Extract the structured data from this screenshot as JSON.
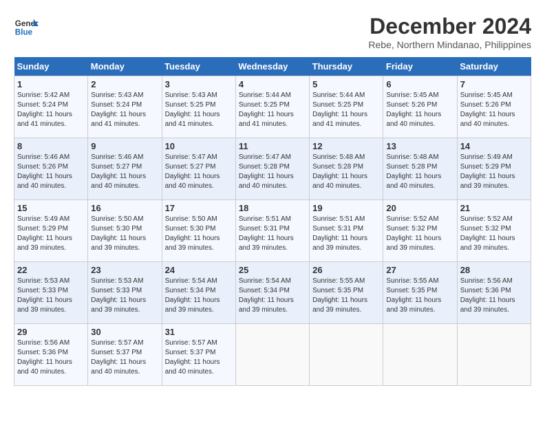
{
  "header": {
    "logo_general": "General",
    "logo_blue": "Blue",
    "month_title": "December 2024",
    "location": "Rebe, Northern Mindanao, Philippines"
  },
  "days_of_week": [
    "Sunday",
    "Monday",
    "Tuesday",
    "Wednesday",
    "Thursday",
    "Friday",
    "Saturday"
  ],
  "weeks": [
    [
      {
        "day": "1",
        "sunrise": "5:42 AM",
        "sunset": "5:24 PM",
        "daylight": "11 hours and 41 minutes."
      },
      {
        "day": "2",
        "sunrise": "5:43 AM",
        "sunset": "5:24 PM",
        "daylight": "11 hours and 41 minutes."
      },
      {
        "day": "3",
        "sunrise": "5:43 AM",
        "sunset": "5:25 PM",
        "daylight": "11 hours and 41 minutes."
      },
      {
        "day": "4",
        "sunrise": "5:44 AM",
        "sunset": "5:25 PM",
        "daylight": "11 hours and 41 minutes."
      },
      {
        "day": "5",
        "sunrise": "5:44 AM",
        "sunset": "5:25 PM",
        "daylight": "11 hours and 41 minutes."
      },
      {
        "day": "6",
        "sunrise": "5:45 AM",
        "sunset": "5:26 PM",
        "daylight": "11 hours and 40 minutes."
      },
      {
        "day": "7",
        "sunrise": "5:45 AM",
        "sunset": "5:26 PM",
        "daylight": "11 hours and 40 minutes."
      }
    ],
    [
      {
        "day": "8",
        "sunrise": "5:46 AM",
        "sunset": "5:26 PM",
        "daylight": "11 hours and 40 minutes."
      },
      {
        "day": "9",
        "sunrise": "5:46 AM",
        "sunset": "5:27 PM",
        "daylight": "11 hours and 40 minutes."
      },
      {
        "day": "10",
        "sunrise": "5:47 AM",
        "sunset": "5:27 PM",
        "daylight": "11 hours and 40 minutes."
      },
      {
        "day": "11",
        "sunrise": "5:47 AM",
        "sunset": "5:28 PM",
        "daylight": "11 hours and 40 minutes."
      },
      {
        "day": "12",
        "sunrise": "5:48 AM",
        "sunset": "5:28 PM",
        "daylight": "11 hours and 40 minutes."
      },
      {
        "day": "13",
        "sunrise": "5:48 AM",
        "sunset": "5:28 PM",
        "daylight": "11 hours and 40 minutes."
      },
      {
        "day": "14",
        "sunrise": "5:49 AM",
        "sunset": "5:29 PM",
        "daylight": "11 hours and 39 minutes."
      }
    ],
    [
      {
        "day": "15",
        "sunrise": "5:49 AM",
        "sunset": "5:29 PM",
        "daylight": "11 hours and 39 minutes."
      },
      {
        "day": "16",
        "sunrise": "5:50 AM",
        "sunset": "5:30 PM",
        "daylight": "11 hours and 39 minutes."
      },
      {
        "day": "17",
        "sunrise": "5:50 AM",
        "sunset": "5:30 PM",
        "daylight": "11 hours and 39 minutes."
      },
      {
        "day": "18",
        "sunrise": "5:51 AM",
        "sunset": "5:31 PM",
        "daylight": "11 hours and 39 minutes."
      },
      {
        "day": "19",
        "sunrise": "5:51 AM",
        "sunset": "5:31 PM",
        "daylight": "11 hours and 39 minutes."
      },
      {
        "day": "20",
        "sunrise": "5:52 AM",
        "sunset": "5:32 PM",
        "daylight": "11 hours and 39 minutes."
      },
      {
        "day": "21",
        "sunrise": "5:52 AM",
        "sunset": "5:32 PM",
        "daylight": "11 hours and 39 minutes."
      }
    ],
    [
      {
        "day": "22",
        "sunrise": "5:53 AM",
        "sunset": "5:33 PM",
        "daylight": "11 hours and 39 minutes."
      },
      {
        "day": "23",
        "sunrise": "5:53 AM",
        "sunset": "5:33 PM",
        "daylight": "11 hours and 39 minutes."
      },
      {
        "day": "24",
        "sunrise": "5:54 AM",
        "sunset": "5:34 PM",
        "daylight": "11 hours and 39 minutes."
      },
      {
        "day": "25",
        "sunrise": "5:54 AM",
        "sunset": "5:34 PM",
        "daylight": "11 hours and 39 minutes."
      },
      {
        "day": "26",
        "sunrise": "5:55 AM",
        "sunset": "5:35 PM",
        "daylight": "11 hours and 39 minutes."
      },
      {
        "day": "27",
        "sunrise": "5:55 AM",
        "sunset": "5:35 PM",
        "daylight": "11 hours and 39 minutes."
      },
      {
        "day": "28",
        "sunrise": "5:56 AM",
        "sunset": "5:36 PM",
        "daylight": "11 hours and 39 minutes."
      }
    ],
    [
      {
        "day": "29",
        "sunrise": "5:56 AM",
        "sunset": "5:36 PM",
        "daylight": "11 hours and 40 minutes."
      },
      {
        "day": "30",
        "sunrise": "5:57 AM",
        "sunset": "5:37 PM",
        "daylight": "11 hours and 40 minutes."
      },
      {
        "day": "31",
        "sunrise": "5:57 AM",
        "sunset": "5:37 PM",
        "daylight": "11 hours and 40 minutes."
      },
      null,
      null,
      null,
      null
    ]
  ],
  "labels": {
    "sunrise": "Sunrise:",
    "sunset": "Sunset:",
    "daylight": "Daylight:"
  }
}
